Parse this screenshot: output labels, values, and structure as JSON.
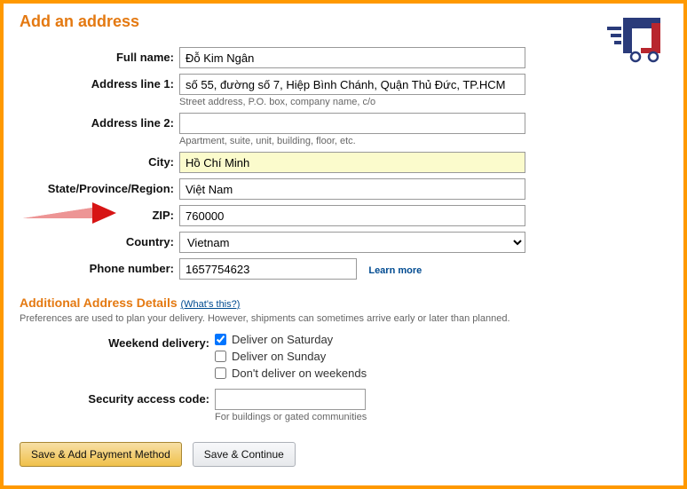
{
  "title": "Add an address",
  "fields": {
    "fullName": {
      "label": "Full name:",
      "value": "Đỗ Kim Ngân"
    },
    "addr1": {
      "label": "Address line 1:",
      "value": "số 55, đường số 7, Hiệp Bình Chánh, Quận Thủ Đức, TP.HCM",
      "hint": "Street address, P.O. box, company name, c/o"
    },
    "addr2": {
      "label": "Address line 2:",
      "value": "",
      "hint": "Apartment, suite, unit, building, floor, etc."
    },
    "city": {
      "label": "City:",
      "value": "Hồ Chí Minh"
    },
    "state": {
      "label": "State/Province/Region:",
      "value": "Việt Nam"
    },
    "zip": {
      "label": "ZIP:",
      "value": "760000"
    },
    "country": {
      "label": "Country:",
      "value": "Vietnam"
    },
    "phone": {
      "label": "Phone number:",
      "value": "1657754623",
      "learnMore": "Learn more"
    }
  },
  "additional": {
    "header": "Additional Address Details",
    "whatsThis": "(What's this?)",
    "note": "Preferences are used to plan your delivery. However, shipments can sometimes arrive early or later than planned.",
    "weekend": {
      "label": "Weekend delivery:",
      "options": [
        {
          "label": "Deliver on Saturday",
          "checked": true
        },
        {
          "label": "Deliver on Sunday",
          "checked": false
        },
        {
          "label": "Don't deliver on weekends",
          "checked": false
        }
      ]
    },
    "security": {
      "label": "Security access code:",
      "value": "",
      "hint": "For buildings or gated communities"
    }
  },
  "buttons": {
    "saveAddPayment": "Save & Add Payment Method",
    "saveContinue": "Save & Continue"
  }
}
